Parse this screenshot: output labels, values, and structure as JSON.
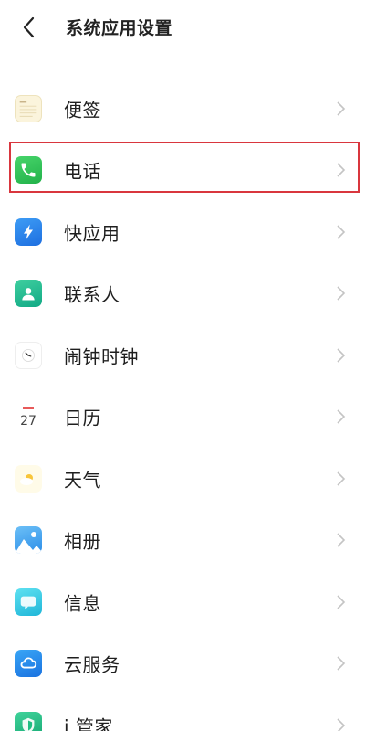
{
  "header": {
    "title": "系统应用设置"
  },
  "items": [
    {
      "label": "便签",
      "icon": "notes-icon"
    },
    {
      "label": "电话",
      "icon": "phone-icon",
      "highlighted": true
    },
    {
      "label": "快应用",
      "icon": "quick-app-icon"
    },
    {
      "label": "联系人",
      "icon": "contacts-icon"
    },
    {
      "label": "闹钟时钟",
      "icon": "clock-icon"
    },
    {
      "label": "日历",
      "icon": "calendar-icon",
      "icon_text": "27"
    },
    {
      "label": "天气",
      "icon": "weather-icon"
    },
    {
      "label": "相册",
      "icon": "album-icon"
    },
    {
      "label": "信息",
      "icon": "messages-icon"
    },
    {
      "label": "云服务",
      "icon": "cloud-service-icon"
    },
    {
      "label": "i 管家",
      "icon": "i-manager-icon"
    }
  ],
  "colors": {
    "highlight_border": "#d9363e",
    "chevron": "#c4c4c4"
  }
}
